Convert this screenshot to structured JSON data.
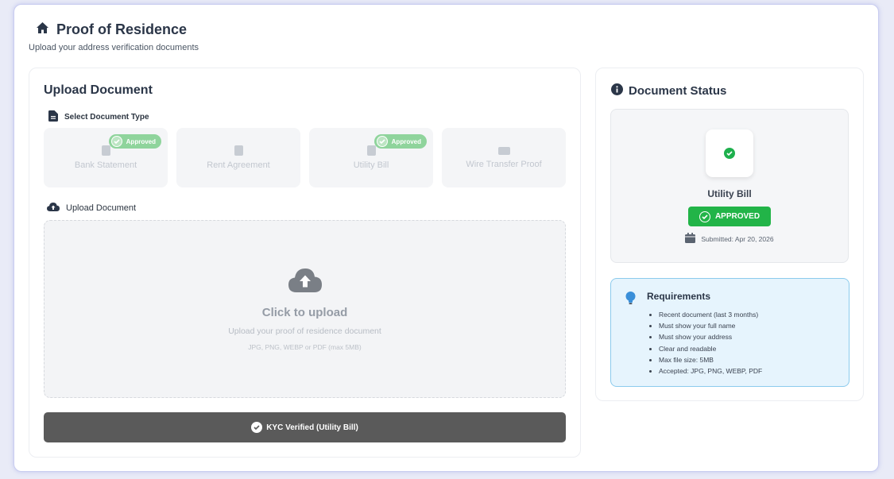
{
  "header": {
    "title": "Proof of Residence",
    "subtitle": "Upload your address verification documents"
  },
  "upload_card": {
    "title": "Upload Document",
    "select_type_label": "Select Document Type",
    "document_types": [
      {
        "label": "Bank Statement",
        "badge": "Approved",
        "icon": "bank-statement-icon"
      },
      {
        "label": "Rent Agreement",
        "badge": "",
        "icon": "rent-agreement-icon"
      },
      {
        "label": "Utility Bill",
        "badge": "Approved",
        "icon": "utility-bill-icon"
      },
      {
        "label": "Wire Transfer Proof",
        "badge": "",
        "icon": "wire-transfer-icon"
      }
    ],
    "upload_label": "Upload Document",
    "dropzone": {
      "title": "Click to upload",
      "description": "Upload your proof of residence document",
      "formats": "JPG, PNG, WEBP or PDF (max 5MB)"
    },
    "kyc_button": "KYC Verified (Utility Bill)"
  },
  "status_card": {
    "title": "Document Status",
    "document_name": "Utility Bill",
    "status": "APPROVED",
    "submitted": "Submitted: Apr 20, 2026"
  },
  "requirements": {
    "title": "Requirements",
    "items": [
      "Recent document (last 3 months)",
      "Must show your full name",
      "Must show your address",
      "Clear and readable",
      "Max file size: 5MB",
      "Accepted: JPG, PNG, WEBP, PDF"
    ]
  },
  "colors": {
    "approved_green": "#22b448",
    "badge_green": "#8fd49c",
    "kyc_bar": "#5a5a5a",
    "requirements_bg": "#e6f4fd",
    "requirements_border": "#8ccbed",
    "heading": "#2b3648"
  }
}
